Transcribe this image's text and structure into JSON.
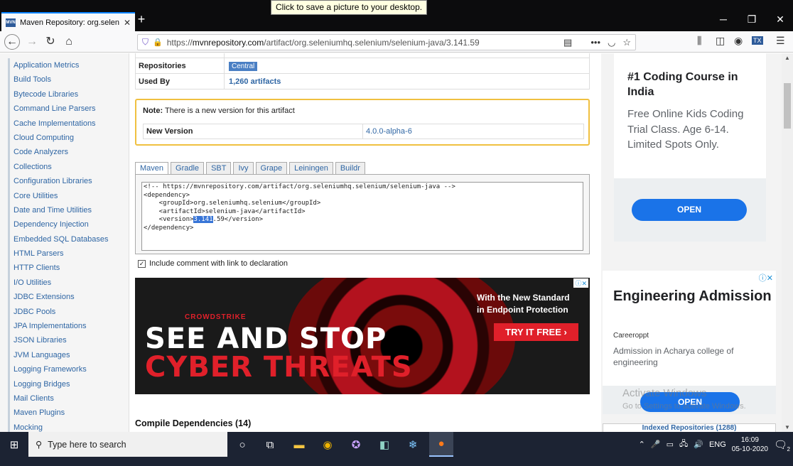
{
  "browser": {
    "tab_title": "Maven Repository: org.seleniu",
    "tab_favicon": "MVN",
    "tooltip": "Click to save a picture to your desktop.",
    "url_prefix": "https://",
    "url_domain": "mvnrepository.com",
    "url_path": "/artifact/org.seleniumhq.selenium/selenium-java/3.141.59"
  },
  "sidebar": {
    "items": [
      "Application Metrics",
      "Build Tools",
      "Bytecode Libraries",
      "Command Line Parsers",
      "Cache Implementations",
      "Cloud Computing",
      "Code Analyzers",
      "Collections",
      "Configuration Libraries",
      "Core Utilities",
      "Date and Time Utilities",
      "Dependency Injection",
      "Embedded SQL Databases",
      "HTML Parsers",
      "HTTP Clients",
      "I/O Utilities",
      "JDBC Extensions",
      "JDBC Pools",
      "JPA Implementations",
      "JSON Libraries",
      "JVM Languages",
      "Logging Frameworks",
      "Logging Bridges",
      "Mail Clients",
      "Maven Plugins",
      "Mocking"
    ]
  },
  "info": {
    "repositories_label": "Repositories",
    "repositories_value": "Central",
    "used_by_label": "Used By",
    "used_by_value": "1,260 artifacts"
  },
  "note": {
    "label": "Note:",
    "text": "There is a new version for this artifact",
    "new_version_label": "New Version",
    "new_version_value": "4.0.0-alpha-6"
  },
  "build_tabs": [
    "Maven",
    "Gradle",
    "SBT",
    "Ivy",
    "Grape",
    "Leiningen",
    "Buildr"
  ],
  "code": {
    "line1": "<!-- https://mvnrepository.com/artifact/org.seleniumhq.selenium/selenium-java -->",
    "line2": "<dependency>",
    "line3": "    <groupId>org.seleniumhq.selenium</groupId>",
    "line4": "    <artifactId>selenium-java</artifactId>",
    "line5_pre": "    <version>",
    "line5_sel": "3.141",
    "line5_post": ".59</version>",
    "line6": "</dependency>"
  },
  "include_comment_label": "Include comment with link to declaration",
  "ad_main": {
    "brand": "CROWDSTRIKE",
    "headline1": "SEE AND STOP",
    "headline2": "CYBER THREATS",
    "tagline1": "With the New Standard",
    "tagline2": "in Endpoint Protection",
    "cta": "TRY IT FREE"
  },
  "compile_deps": "Compile Dependencies (14)",
  "ad_right1": {
    "title": "#1 Coding Course in India",
    "body": "Free Online Kids Coding Trial Class. Age 6-14. Limited Spots Only.",
    "cta": "OPEN"
  },
  "ad_right2": {
    "title": "Engineering Admission",
    "source": "Careeroppt",
    "body": "Admission in Acharya college of engineering",
    "cta": "OPEN"
  },
  "watermark": {
    "line1": "Activate Windows",
    "line2": "Go to Settings to activate Windows."
  },
  "indexed_repos": "Indexed Repositories (1288)",
  "taskbar": {
    "search_placeholder": "Type here to search",
    "lang": "ENG",
    "time": "16:09",
    "date": "05-10-2020",
    "notif_count": "2"
  }
}
